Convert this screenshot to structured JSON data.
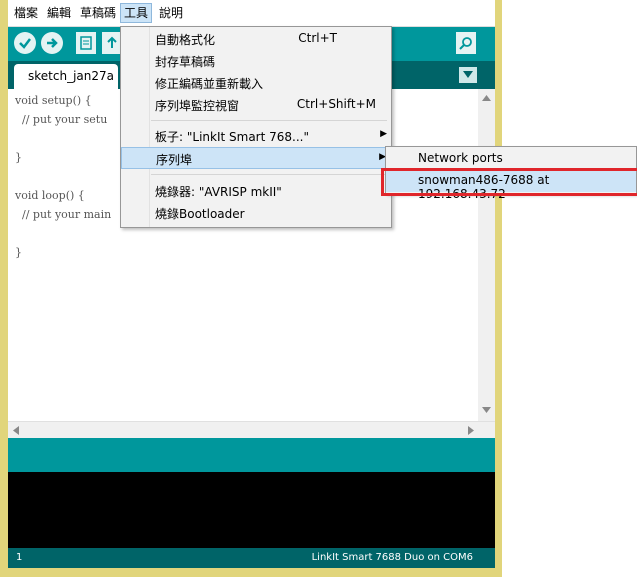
{
  "menubar": [
    "檔案",
    "編輯",
    "草稿碼",
    "工具",
    "說明"
  ],
  "tab": {
    "label": "sketch_jan27a"
  },
  "editor_lines": [
    "void setup() {",
    "  // put your setu",
    "",
    "}",
    "",
    "void loop() {",
    "  // put your main",
    "",
    "}"
  ],
  "tools_menu": {
    "auto_format": {
      "label": "自動格式化",
      "shortcut": "Ctrl+T"
    },
    "archive_sketch": {
      "label": "封存草稿碼"
    },
    "fix_encoding": {
      "label": "修正編碼並重新載入"
    },
    "serial_monitor": {
      "label": "序列埠監控視窗",
      "shortcut": "Ctrl+Shift+M"
    },
    "board": {
      "label": "板子: \"LinkIt Smart 768...\""
    },
    "port": {
      "label": "序列埠"
    },
    "programmer": {
      "label": "燒錄器: \"AVRISP mkII\""
    },
    "burn_bootloader": {
      "label": "燒錄Bootloader"
    }
  },
  "port_submenu": {
    "header": "Network ports",
    "item": "snowman486-7688 at 192.168.43.72"
  },
  "status": {
    "line": "1",
    "board": "LinkIt Smart 7688 Duo on COM6"
  },
  "colors": {
    "teal": "#00979c",
    "dark_teal": "#006468",
    "highlight": "#e0262b"
  }
}
